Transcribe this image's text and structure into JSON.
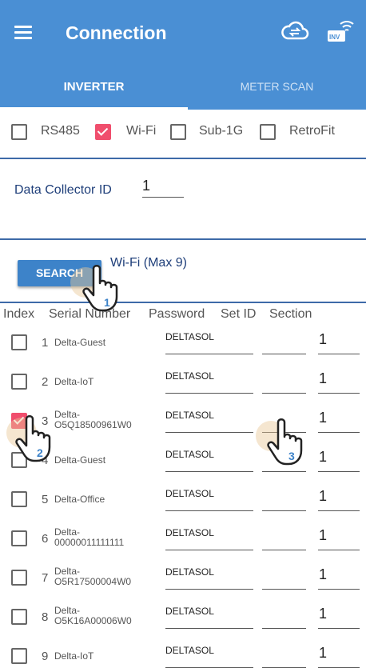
{
  "app_bar": {
    "title": "Connection",
    "icons": [
      "menu-icon",
      "cloud-sync-icon",
      "inverter-wifi-icon"
    ],
    "inverter_badge": "INV"
  },
  "tabs": [
    {
      "label": "INVERTER",
      "selected": true
    },
    {
      "label": "METER SCAN",
      "selected": false
    }
  ],
  "interfaces": [
    {
      "label": "RS485",
      "checked": false
    },
    {
      "label": "Wi-Fi",
      "checked": true
    },
    {
      "label": "Sub-1G",
      "checked": false
    },
    {
      "label": "RetroFit",
      "checked": false
    }
  ],
  "data_collector": {
    "label": "Data Collector ID",
    "value": "1"
  },
  "search": {
    "button_label": "SEARCH",
    "wifi_label": "Wi-Fi (Max 9)"
  },
  "columns": [
    "Index",
    "Serial Number",
    "Password",
    "Set ID",
    "Section"
  ],
  "rows": [
    {
      "index": "1",
      "serial": "Delta-Guest",
      "password": "DELTASOL",
      "set_id": "",
      "section": "1",
      "checked": false
    },
    {
      "index": "2",
      "serial": "Delta-IoT",
      "password": "DELTASOL",
      "set_id": "",
      "section": "1",
      "checked": false
    },
    {
      "index": "3",
      "serial": "Delta-\nO5Q18500961W0",
      "password": "DELTASOL",
      "set_id": "",
      "section": "1",
      "checked": true
    },
    {
      "index": "4",
      "serial": "Delta-Guest",
      "password": "DELTASOL",
      "set_id": "",
      "section": "1",
      "checked": false
    },
    {
      "index": "5",
      "serial": "Delta-Office",
      "password": "DELTASOL",
      "set_id": "",
      "section": "1",
      "checked": false
    },
    {
      "index": "6",
      "serial": "Delta-\n00000011111111",
      "password": "DELTASOL",
      "set_id": "",
      "section": "1",
      "checked": false
    },
    {
      "index": "7",
      "serial": "Delta-\nO5R17500004W0",
      "password": "DELTASOL",
      "set_id": "",
      "section": "1",
      "checked": false
    },
    {
      "index": "8",
      "serial": "Delta-\nO5K16A00006W0",
      "password": "DELTASOL",
      "set_id": "",
      "section": "1",
      "checked": false
    },
    {
      "index": "9",
      "serial": "Delta-IoT",
      "password": "DELTASOL",
      "set_id": "",
      "section": "1",
      "checked": false
    }
  ],
  "step_markers": [
    {
      "number": "1",
      "target": "search-button"
    },
    {
      "number": "2",
      "target": "row-3-checkbox"
    },
    {
      "number": "3",
      "target": "row-3-set-id"
    }
  ],
  "colors": {
    "app_bar": "#4a8fd4",
    "checked": "#f04e6d",
    "accent_text": "#1f3f7a",
    "divider": "#3e6aa8"
  }
}
